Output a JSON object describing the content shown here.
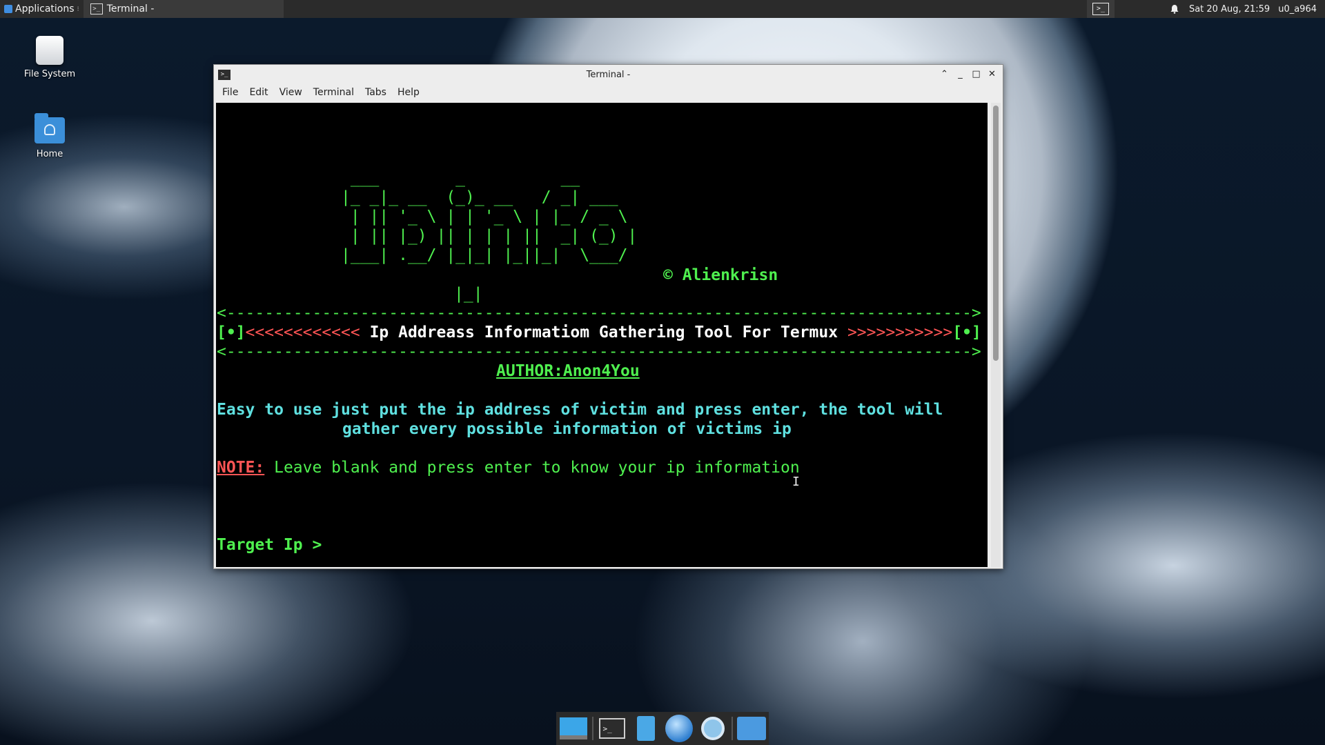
{
  "top_panel": {
    "applications_label": "Applications",
    "task_title": "Terminal -",
    "clock": "Sat 20 Aug, 21:59",
    "user": "u0_a964"
  },
  "desktop_icons": [
    {
      "label": "File System",
      "icon": "drive-icon"
    },
    {
      "label": "Home",
      "icon": "home-folder-icon"
    }
  ],
  "window": {
    "title": "Terminal -",
    "menu": [
      "File",
      "Edit",
      "View",
      "Terminal",
      "Tabs",
      "Help"
    ]
  },
  "terminal": {
    "banner": "              ___        _          __\n             |_ _|_ __  (_)_ __   / _| ___\n              | || '_ \\ | | '_ \\ | |_ / _ \\\n              | || |_) || | | | ||  _| (_) |\n             |___| .__/ |_|_| |_||_|  \\___/",
    "banner_tail": "|_|",
    "copyright": "© Alienkrisn",
    "separator": "<------------------------------------------------------------------------------>",
    "header_left_bullet": "[•]",
    "header_left_arrows": "<<<<<<<<<<<<",
    "header_title": " Ip Addreass Informatiom Gathering Tool For Termux ",
    "header_right_arrows": ">>>>>>>>>>>",
    "header_right_bullet": "[•]",
    "author": "AUTHOR:Anon4You",
    "desc_line1": "Easy to use just put the ip address of victim and press enter, the tool will",
    "desc_line2": "gather every possible information of victims ip",
    "note_label": "NOTE:",
    "note_text": " Leave blank and press enter to know your ip information",
    "prompt": "Target Ip > "
  },
  "dock": [
    "desktop-icon",
    "terminal-icon",
    "file-manager-icon",
    "web-browser-icon",
    "app-finder-icon",
    "folder-icon"
  ],
  "colors": {
    "term_green": "#4ff04f",
    "term_red": "#ff5555",
    "term_cyan": "#5fe0e0",
    "panel_bg": "#2b2b2b"
  }
}
